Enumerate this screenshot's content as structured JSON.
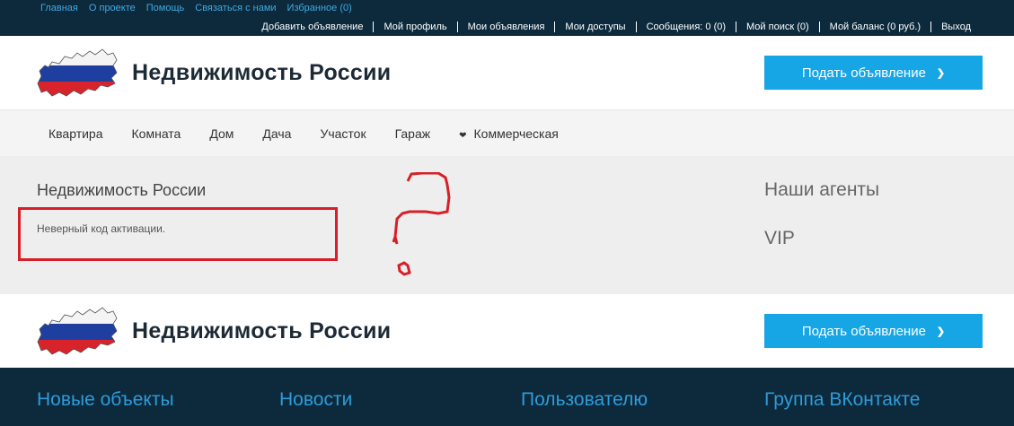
{
  "topbar": {
    "links": [
      "Главная",
      "О проекте",
      "Помощь",
      "Связаться с нами",
      "Избранное (0)"
    ],
    "usermenu": [
      "Добавить объявление",
      "Мой профиль",
      "Мои объявления",
      "Мои доступы",
      "Сообщения: 0 (0)",
      "Мой поиск (0)",
      "Мой баланс (0 руб.)",
      "Выход"
    ]
  },
  "header": {
    "site_title": "Недвижимость России",
    "cta_label": "Подать объявление",
    "cta_icon": "chevron-right-icon",
    "logo_icon": "russia-flag-map-icon"
  },
  "nav": {
    "items": [
      "Квартира",
      "Комната",
      "Дом",
      "Дача",
      "Участок",
      "Гараж",
      "Коммерческая"
    ],
    "dropdown_icon": "heart-icon"
  },
  "content": {
    "title": "Недвижимость России",
    "message": "Неверный код активации.",
    "annotation_color": "#d71f27"
  },
  "sidebar": {
    "agents_heading": "Наши агенты",
    "vip_heading": "VIP"
  },
  "footer": {
    "columns": [
      "Новые объекты",
      "Новости",
      "Пользователю",
      "Группа ВКонтакте"
    ]
  },
  "colors": {
    "topbar_bg": "#0d2a3d",
    "accent": "#16a6e6",
    "link": "#3fa9e0"
  }
}
